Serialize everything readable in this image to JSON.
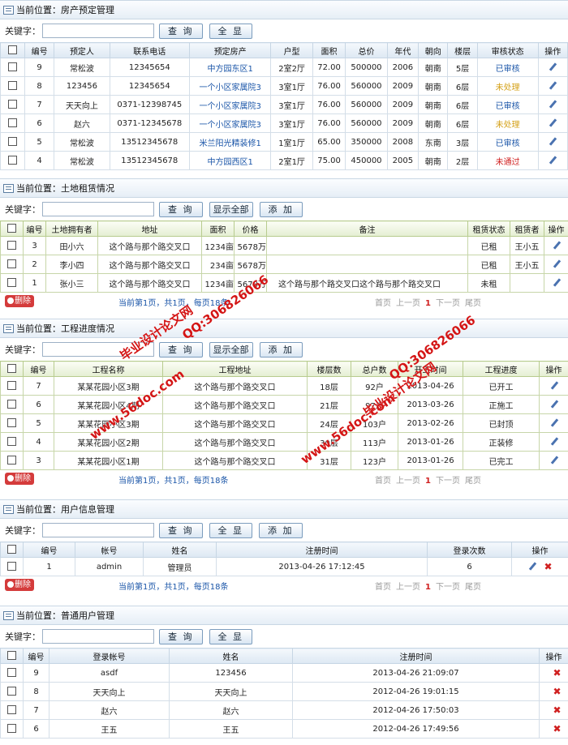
{
  "location_label": "当前位置：",
  "keyword_label": "关键字：",
  "icons": {
    "edit": "pencil-icon",
    "delete": "x-icon",
    "header": "list-icon"
  },
  "colors": {
    "approved": "#1a55a8",
    "pending": "#d4a017",
    "rejected": "#d02020"
  },
  "s1": {
    "title": "房产预定管理",
    "query": "查 询",
    "showall": "全 显",
    "cols": [
      "编号",
      "预定人",
      "联系电话",
      "预定房产",
      "户型",
      "面积",
      "总价",
      "年代",
      "朝向",
      "楼层",
      "审核状态",
      "操作"
    ],
    "rows": [
      [
        "9",
        "常松波",
        "12345654",
        "中方园东区1",
        "2室2厅",
        "72.00",
        "500000",
        "2006",
        "朝南",
        "5层",
        "已审核"
      ],
      [
        "8",
        "123456",
        "12345654",
        "一个小区家属院3",
        "3室1厅",
        "76.00",
        "560000",
        "2009",
        "朝南",
        "6层",
        "未处理"
      ],
      [
        "7",
        "天天向上",
        "0371-12398745",
        "一个小区家属院3",
        "3室1厅",
        "76.00",
        "560000",
        "2009",
        "朝南",
        "6层",
        "已审核"
      ],
      [
        "6",
        "赵六",
        "0371-12345678",
        "一个小区家属院3",
        "3室1厅",
        "76.00",
        "560000",
        "2009",
        "朝南",
        "6层",
        "未处理"
      ],
      [
        "5",
        "常松波",
        "13512345678",
        "米兰阳光精装修1",
        "1室1厅",
        "65.00",
        "350000",
        "2008",
        "东南",
        "3层",
        "已审核"
      ],
      [
        "4",
        "常松波",
        "13512345678",
        "中方园西区1",
        "2室1厅",
        "75.00",
        "450000",
        "2005",
        "朝南",
        "2层",
        "未通过"
      ]
    ]
  },
  "s2": {
    "title": "土地租赁情况",
    "query": "查 询",
    "showall": "显示全部",
    "add": "添 加",
    "cols": [
      "编号",
      "土地拥有者",
      "地址",
      "面积",
      "价格",
      "备注",
      "租赁状态",
      "租赁者",
      "操作"
    ],
    "rows": [
      [
        "3",
        "田小六",
        "这个路与那个路交叉口",
        "1234亩",
        "5678万",
        "",
        "已租",
        "王小五"
      ],
      [
        "2",
        "李小四",
        "这个路与那个路交叉口",
        "234亩",
        "5678万",
        "",
        "已租",
        "王小五"
      ],
      [
        "1",
        "张小三",
        "这个路与那个路交叉口",
        "1234亩",
        "5678万",
        "这个路与那个路交叉口这个路与那个路交叉口",
        "未租",
        ""
      ]
    ],
    "del": "删除",
    "pager": {
      "pre": "当前第",
      "page": "1",
      "mid1": "页，共",
      "total": "1",
      "mid2": "页，每页",
      "per": "18",
      "post": "条"
    },
    "nav": {
      "first": "首页",
      "prev": "上一页",
      "cur": "1",
      "next": "下一页",
      "last": "尾页"
    }
  },
  "s3": {
    "title": "工程进度情况",
    "query": "查 询",
    "showall": "显示全部",
    "add": "添 加",
    "cols": [
      "编号",
      "工程名称",
      "工程地址",
      "楼层数",
      "总户数",
      "开工时间",
      "工程进度",
      "操作"
    ],
    "rows": [
      [
        "7",
        "某某花园小区3期",
        "这个路与那个路交叉口",
        "18层",
        "92户",
        "2013-04-26",
        "已开工"
      ],
      [
        "6",
        "某某花园小区4期",
        "这个路与那个路交叉口",
        "21层",
        "97户",
        "2013-03-26",
        "正施工"
      ],
      [
        "5",
        "某某花园小区3期",
        "这个路与那个路交叉口",
        "24层",
        "103户",
        "2013-02-26",
        "已封顶"
      ],
      [
        "4",
        "某某花园小区2期",
        "这个路与那个路交叉口",
        "30层",
        "113户",
        "2013-01-26",
        "正装修"
      ],
      [
        "3",
        "某某花园小区1期",
        "这个路与那个路交叉口",
        "31层",
        "123户",
        "2013-01-26",
        "已完工"
      ]
    ],
    "del": "删除",
    "pager": {
      "pre": "当前第",
      "page": "1",
      "mid1": "页，共",
      "total": "1",
      "mid2": "页，每页",
      "per": "18",
      "post": "条"
    },
    "nav": {
      "first": "首页",
      "prev": "上一页",
      "cur": "1",
      "next": "下一页",
      "last": "尾页"
    }
  },
  "s4": {
    "title": "用户信息管理",
    "query": "查 询",
    "showall": "全 显",
    "add": "添 加",
    "cols": [
      "编号",
      "帐号",
      "姓名",
      "注册时间",
      "登录次数",
      "操作"
    ],
    "rows": [
      [
        "1",
        "admin",
        "管理员",
        "2013-04-26 17:12:45",
        "6"
      ]
    ],
    "del": "删除",
    "pager": {
      "pre": "当前第",
      "page": "1",
      "mid1": "页，共",
      "total": "1",
      "mid2": "页，每页",
      "per": "18",
      "post": "条"
    },
    "nav": {
      "first": "首页",
      "prev": "上一页",
      "cur": "1",
      "next": "下一页",
      "last": "尾页"
    }
  },
  "s5": {
    "title": "普通用户管理",
    "query": "查 询",
    "showall": "全 显",
    "cols": [
      "编号",
      "登录帐号",
      "姓名",
      "注册时间",
      "操作"
    ],
    "rows": [
      [
        "9",
        "asdf",
        "123456",
        "2013-04-26 21:09:07"
      ],
      [
        "8",
        "天天向上",
        "天天向上",
        "2012-04-26 19:01:15"
      ],
      [
        "7",
        "赵六",
        "赵六",
        "2012-04-26 17:50:03"
      ],
      [
        "6",
        "王五",
        "王五",
        "2012-04-26 17:49:56"
      ]
    ]
  },
  "watermark": {
    "a": "毕业设计论文网",
    "b": "QQ:306826066",
    "c": "www.56doc.com"
  }
}
